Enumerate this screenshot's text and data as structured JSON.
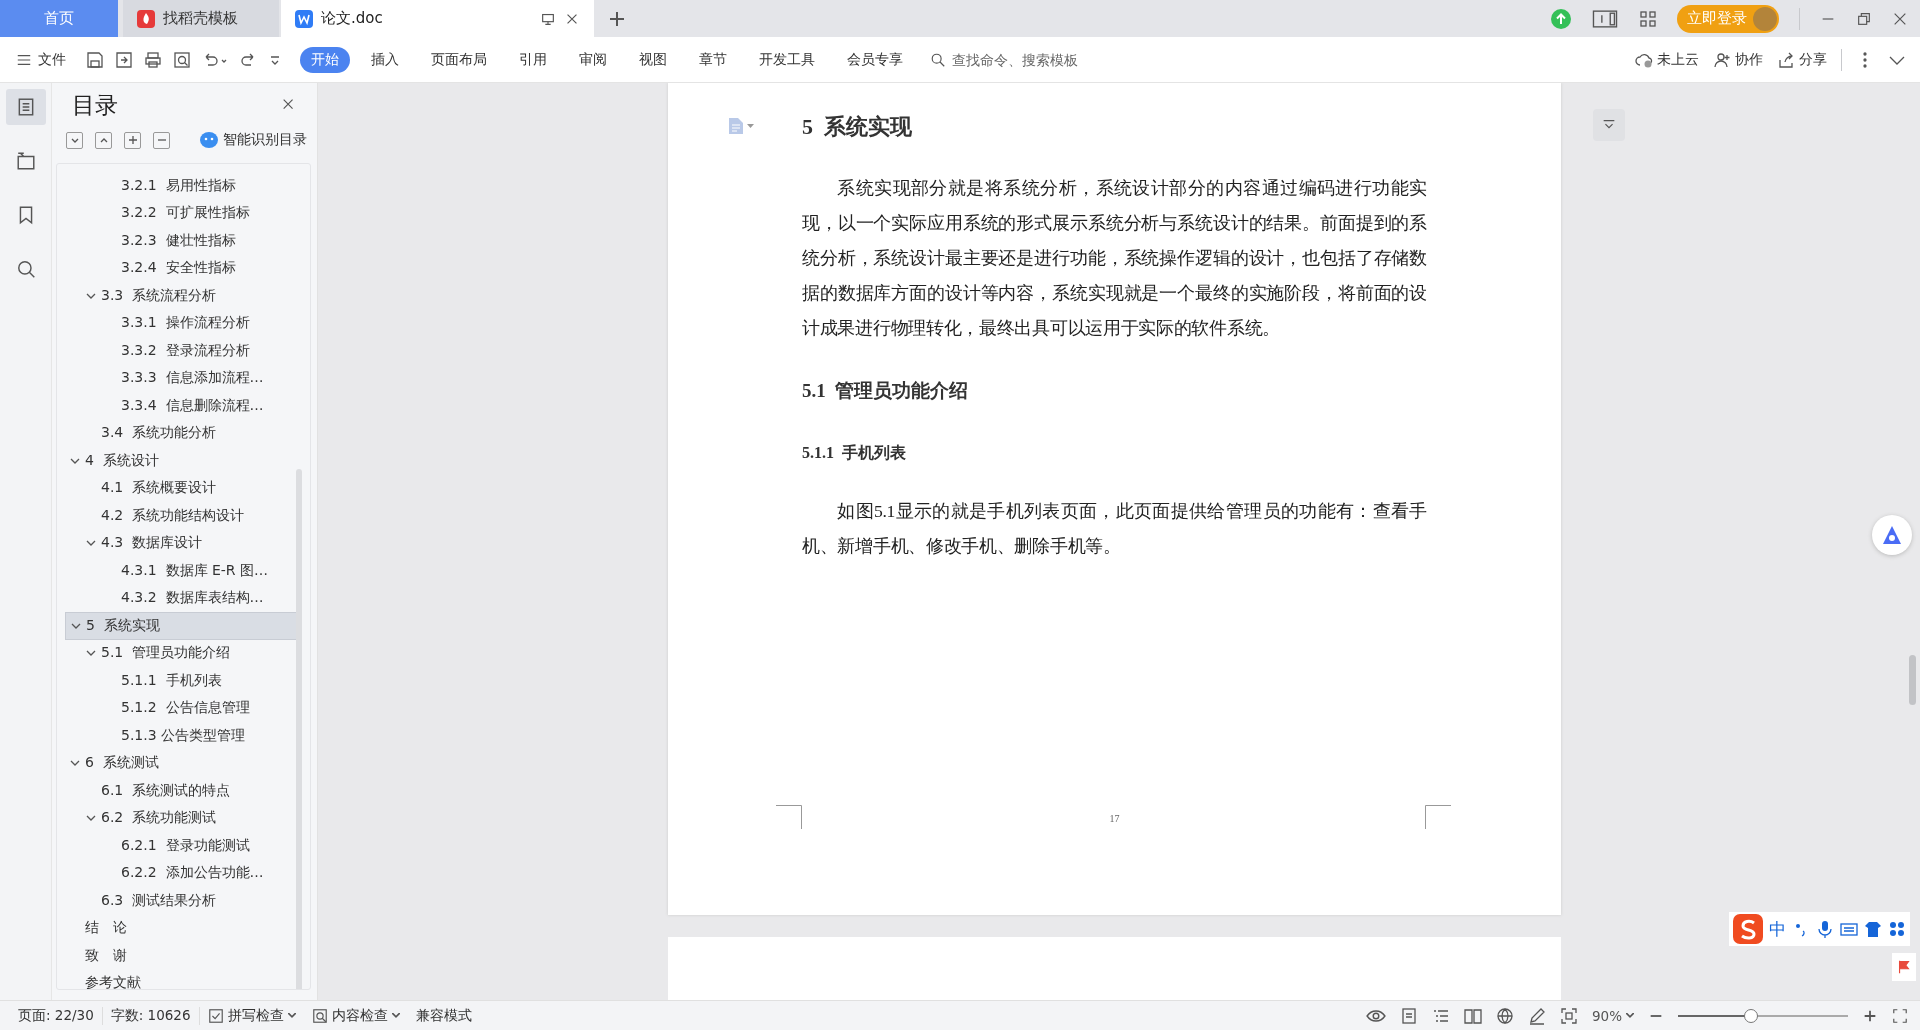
{
  "tabs": [
    {
      "label": "首页",
      "kind": "home",
      "selected": false
    },
    {
      "label": "找稻壳模板",
      "kind": "template",
      "selected": false
    },
    {
      "label": "论文.doc",
      "kind": "doc",
      "selected": true
    }
  ],
  "account": {
    "login": "立即登录"
  },
  "menu": {
    "file": "文件"
  },
  "ribbon_tabs": [
    {
      "label": "开始",
      "selected": true
    },
    {
      "label": "插入",
      "selected": false
    },
    {
      "label": "页面布局",
      "selected": false
    },
    {
      "label": "引用",
      "selected": false
    },
    {
      "label": "审阅",
      "selected": false
    },
    {
      "label": "视图",
      "selected": false
    },
    {
      "label": "章节",
      "selected": false
    },
    {
      "label": "开发工具",
      "selected": false
    },
    {
      "label": "会员专享",
      "selected": false
    }
  ],
  "search": {
    "placeholder": "查找命令、搜索模板"
  },
  "actions": [
    {
      "kind": "cloud",
      "label": "未上云"
    },
    {
      "kind": "collab",
      "label": "协作"
    },
    {
      "kind": "share",
      "label": "分享"
    }
  ],
  "toc": {
    "title": "目录",
    "smart_button": "智能识别目录",
    "outline": [
      {
        "children": [
          {
            "children": [
              {
                "label": "3.2.1  易用性指标",
                "selected": false
              },
              {
                "label": "3.2.2  可扩展性指标",
                "selected": false
              },
              {
                "label": "3.2.3  健壮性指标",
                "selected": false
              },
              {
                "label": "3.2.4  安全性指标",
                "selected": false
              }
            ]
          },
          {
            "label": "3.3  系统流程分析",
            "selected": false,
            "expanded": true,
            "children": [
              {
                "label": "3.3.1  操作流程分析",
                "selected": false
              },
              {
                "label": "3.3.2  登录流程分析",
                "selected": false
              },
              {
                "label": "3.3.3  信息添加流程…",
                "selected": false
              },
              {
                "label": "3.3.4  信息删除流程…",
                "selected": false
              }
            ]
          },
          {
            "label": "3.4  系统功能分析",
            "selected": false
          }
        ]
      },
      {
        "label": "4  系统设计",
        "selected": false,
        "expanded": true,
        "children": [
          {
            "label": "4.1  系统概要设计",
            "selected": false
          },
          {
            "label": "4.2  系统功能结构设计",
            "selected": false
          },
          {
            "label": "4.3  数据库设计",
            "selected": false,
            "expanded": true,
            "children": [
              {
                "label": "4.3.1  数据库 E-R 图…",
                "selected": false
              },
              {
                "label": "4.3.2  数据库表结构…",
                "selected": false
              }
            ]
          }
        ]
      },
      {
        "label": "5  系统实现",
        "selected": true,
        "expanded": true,
        "children": [
          {
            "label": "5.1  管理员功能介绍",
            "selected": false,
            "expanded": true,
            "children": [
              {
                "label": "5.1.1  手机列表",
                "selected": false
              },
              {
                "label": "5.1.2  公告信息管理",
                "selected": false
              },
              {
                "label": "5.1.3 公告类型管理",
                "selected": false
              }
            ]
          }
        ]
      },
      {
        "label": "6  系统测试",
        "selected": false,
        "expanded": true,
        "children": [
          {
            "label": "6.1  系统测试的特点",
            "selected": false
          },
          {
            "label": "6.2  系统功能测试",
            "selected": false,
            "expanded": true,
            "children": [
              {
                "label": "6.2.1  登录功能测试",
                "selected": false
              },
              {
                "label": "6.2.2  添加公告功能…",
                "selected": false
              }
            ]
          },
          {
            "label": "6.3  测试结果分析",
            "selected": false
          }
        ]
      },
      {
        "label": "结　论",
        "selected": false
      },
      {
        "label": "致　谢",
        "selected": false
      },
      {
        "label": "参考文献",
        "selected": false
      }
    ]
  },
  "document": {
    "blocks": [
      {
        "kind": "h1",
        "text": "5  系统实现"
      },
      {
        "kind": "p",
        "text": "系统实现部分就是将系统分析，系统设计部分的内容通过编码进行功能实现，以一个实际应用系统的形式展示系统分析与系统设计的结果。前面提到的系统分析，系统设计最主要还是进行功能，系统操作逻辑的设计，也包括了存储数据的数据库方面的设计等内容，系统实现就是一个最终的实施阶段，将前面的设计成果进行物理转化，最终出具可以运用于实际的软件系统。"
      },
      {
        "kind": "h2",
        "text": "5.1  管理员功能介绍"
      },
      {
        "kind": "h3",
        "text": "5.1.1  手机列表"
      },
      {
        "kind": "p",
        "text": "如图5.1显示的就是手机列表页面，此页面提供给管理员的功能有：查看手机、新增手机、修改手机、删除手机等。"
      }
    ],
    "page_number": "17"
  },
  "ime": {
    "mode": "中"
  },
  "status_bar": {
    "page": "页面: 22/30",
    "words": "字数: 10626",
    "spell_check": "拼写检查",
    "content_check": "内容检查",
    "mode": "兼容模式",
    "zoom": "90%",
    "zoom_slider": {
      "level": 0.43
    }
  }
}
